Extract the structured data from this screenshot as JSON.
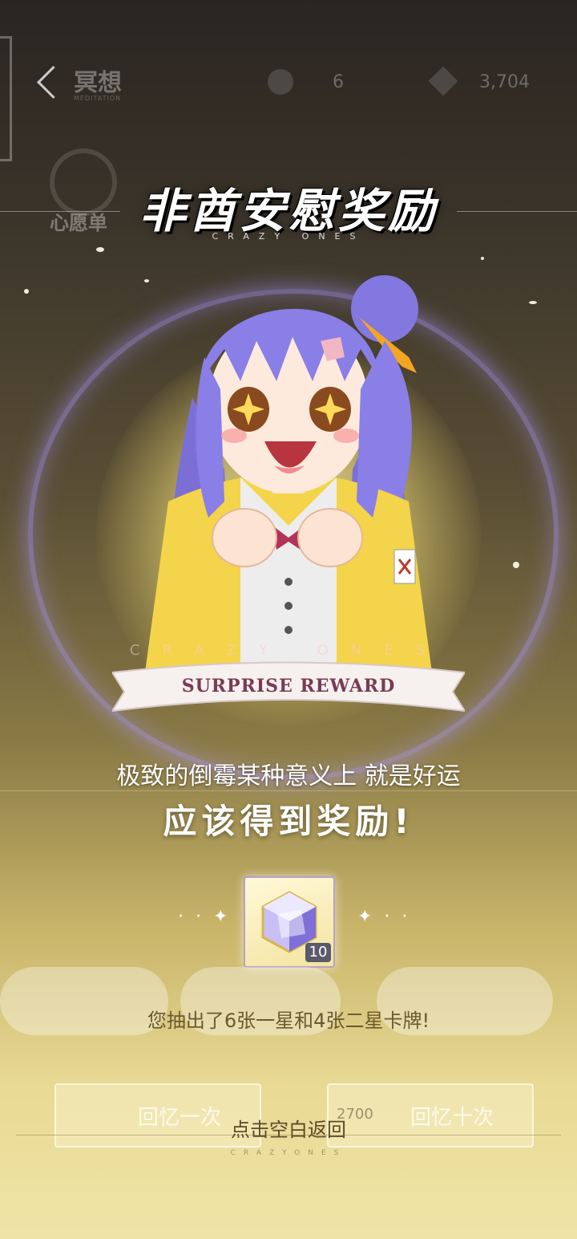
{
  "header": {
    "mode_title": "冥想",
    "mode_subtitle": "MEDITATION",
    "resource1_value": "6",
    "resource2_value": "3,704",
    "wishlist_label": "心愿单"
  },
  "title": {
    "main": "非酋安慰奖励",
    "sub": "CRAZY ONES"
  },
  "banner": {
    "arc_text": "CRAZY ONES",
    "ribbon_text": "SURPRISE REWARD"
  },
  "message": {
    "line1": "极致的倒霉某种意义上 就是好运",
    "line2": "应该得到奖励!"
  },
  "reward": {
    "icon": "crystal-cube-icon",
    "count": "10"
  },
  "result_text": "您抽出了6张一星和4张二星卡牌!",
  "buttons": {
    "single_label": "回忆一次",
    "ten_label": "回忆十次",
    "ten_cost": "2700"
  },
  "footer": {
    "tap_return": "点击空白返回",
    "brand": "CRAZYONES"
  },
  "colors": {
    "ribbon_text": "#7a3a55",
    "ring": "#aa96ff",
    "accent_gold": "#efe4a6"
  }
}
